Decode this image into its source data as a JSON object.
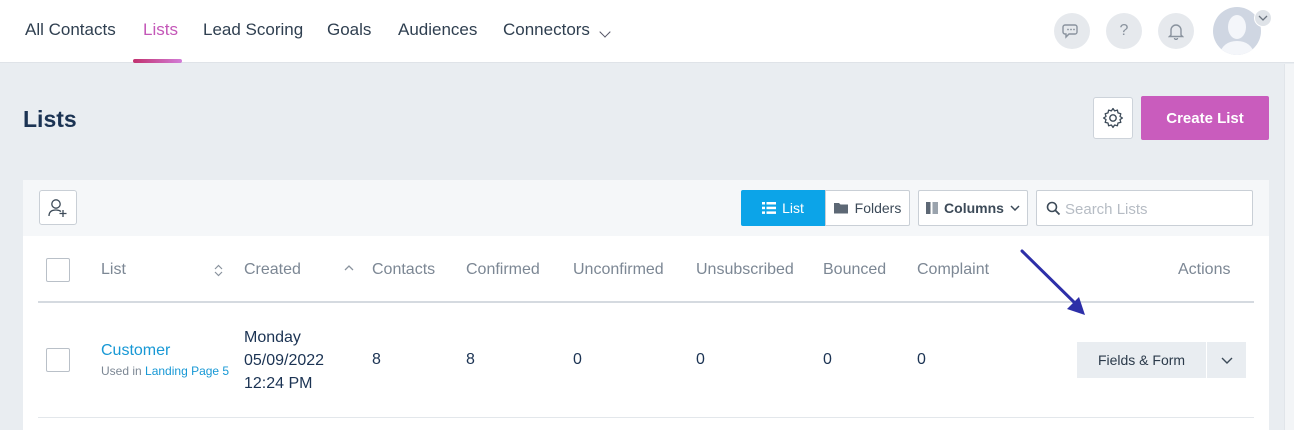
{
  "nav": {
    "items": [
      {
        "label": "All Contacts"
      },
      {
        "label": "Lists"
      },
      {
        "label": "Lead Scoring"
      },
      {
        "label": "Goals"
      },
      {
        "label": "Audiences"
      },
      {
        "label": "Connectors"
      }
    ],
    "active": "Lists",
    "help_label": "?"
  },
  "page": {
    "title": "Lists",
    "create_label": "Create List"
  },
  "toolbar": {
    "list_label": "List",
    "folders_label": "Folders",
    "columns_label": "Columns",
    "search_placeholder": "Search Lists"
  },
  "table": {
    "headers": [
      "List",
      "Created",
      "Contacts",
      "Confirmed",
      "Unconfirmed",
      "Unsubscribed",
      "Bounced",
      "Complaint",
      "Actions"
    ],
    "rows": [
      {
        "name": "Customer",
        "used_in_prefix": "Used in",
        "used_in_link": "Landing Page 5",
        "created_day": "Monday",
        "created_date": "05/09/2022",
        "created_time": "12:24 PM",
        "contacts": "8",
        "confirmed": "8",
        "unconfirmed": "0",
        "unsubscribed": "0",
        "bounced": "0",
        "complaint": "0",
        "action_label": "Fields & Form"
      }
    ]
  },
  "colors": {
    "accent_pink": "#c95cbd",
    "accent_blue": "#0ca4e8",
    "link_blue": "#1798d5",
    "annotation_arrow": "#2d2fa8"
  }
}
